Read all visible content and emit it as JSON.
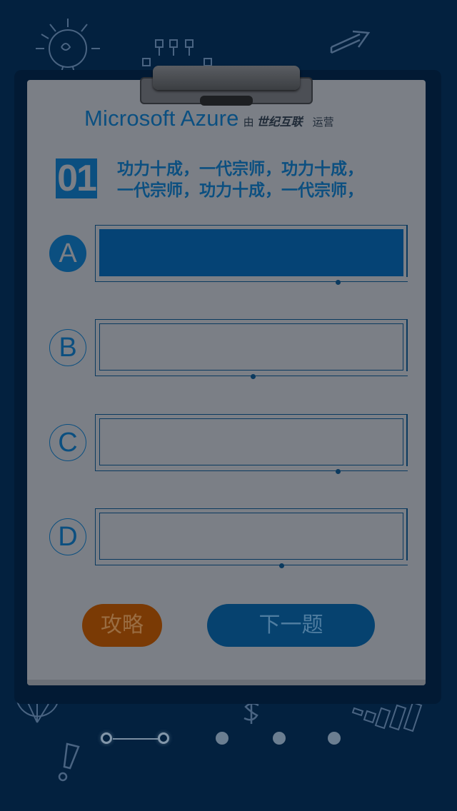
{
  "brand": {
    "name": "Microsoft Azure",
    "by": "由",
    "partner": "世纪互联",
    "operated": "运营"
  },
  "question": {
    "number": "01",
    "line1": "功力十成，一代宗师，功力十成，",
    "line2": "一代宗师，功力十成，一代宗师，"
  },
  "options": [
    {
      "letter": "A",
      "text": "",
      "selected": true
    },
    {
      "letter": "B",
      "text": "",
      "selected": false
    },
    {
      "letter": "C",
      "text": "",
      "selected": false
    },
    {
      "letter": "D",
      "text": "",
      "selected": false
    }
  ],
  "buttons": {
    "hint": "攻略",
    "next": "下一题"
  },
  "pager": {
    "total": 5,
    "current": 2
  },
  "colors": {
    "background": "#03213f",
    "accent": "#0b4f80",
    "hint_button": "#7a3a05",
    "paper": "#7b7f86"
  },
  "icons": [
    "lightbulb-doodle",
    "flowchart-doodle",
    "arrow-doodle",
    "dollar-doodle",
    "exclamation-doodle",
    "pie-doodle",
    "bars-doodle"
  ]
}
